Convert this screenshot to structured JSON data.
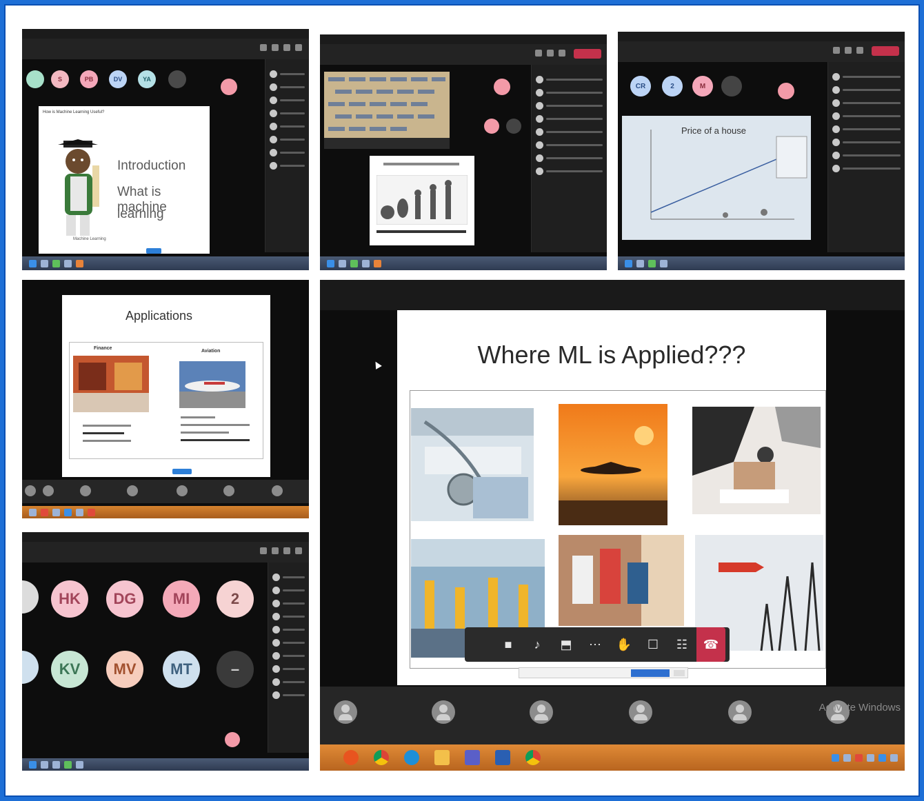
{
  "collage": {
    "s1": {
      "avatars": [
        "S",
        "PB",
        "DV",
        "YA"
      ],
      "slide_heading": "How is Machine Learning Useful?",
      "slide_lines": [
        "Introduction",
        "What is machine",
        "learning"
      ],
      "caption": "Machine Learning"
    },
    "s3": {
      "chart_title": "Price of a house",
      "avatars": [
        "CR",
        "2",
        "M"
      ]
    },
    "s4": {
      "slide_title": "Applications",
      "col1": "Finance",
      "col2": "Aviation"
    },
    "s5": {
      "avatars_row1": [
        "HK",
        "DG",
        "MI",
        "2"
      ],
      "avatars_row2": [
        "KV",
        "MV",
        "MT"
      ]
    },
    "s6": {
      "slide_title": "Where ML is Applied???",
      "watermark": "Activate Windows"
    }
  },
  "colors": {
    "frame_border": "#1e6fd6",
    "teams_dark": "#0d0d0d",
    "leave_red": "#c4314b",
    "hang_up_red": "#c4314b"
  },
  "icons": [
    "video-icon",
    "mic-icon",
    "share-icon",
    "more-icon",
    "raise-hand-icon",
    "chat-icon",
    "people-icon",
    "hang-up-icon"
  ]
}
